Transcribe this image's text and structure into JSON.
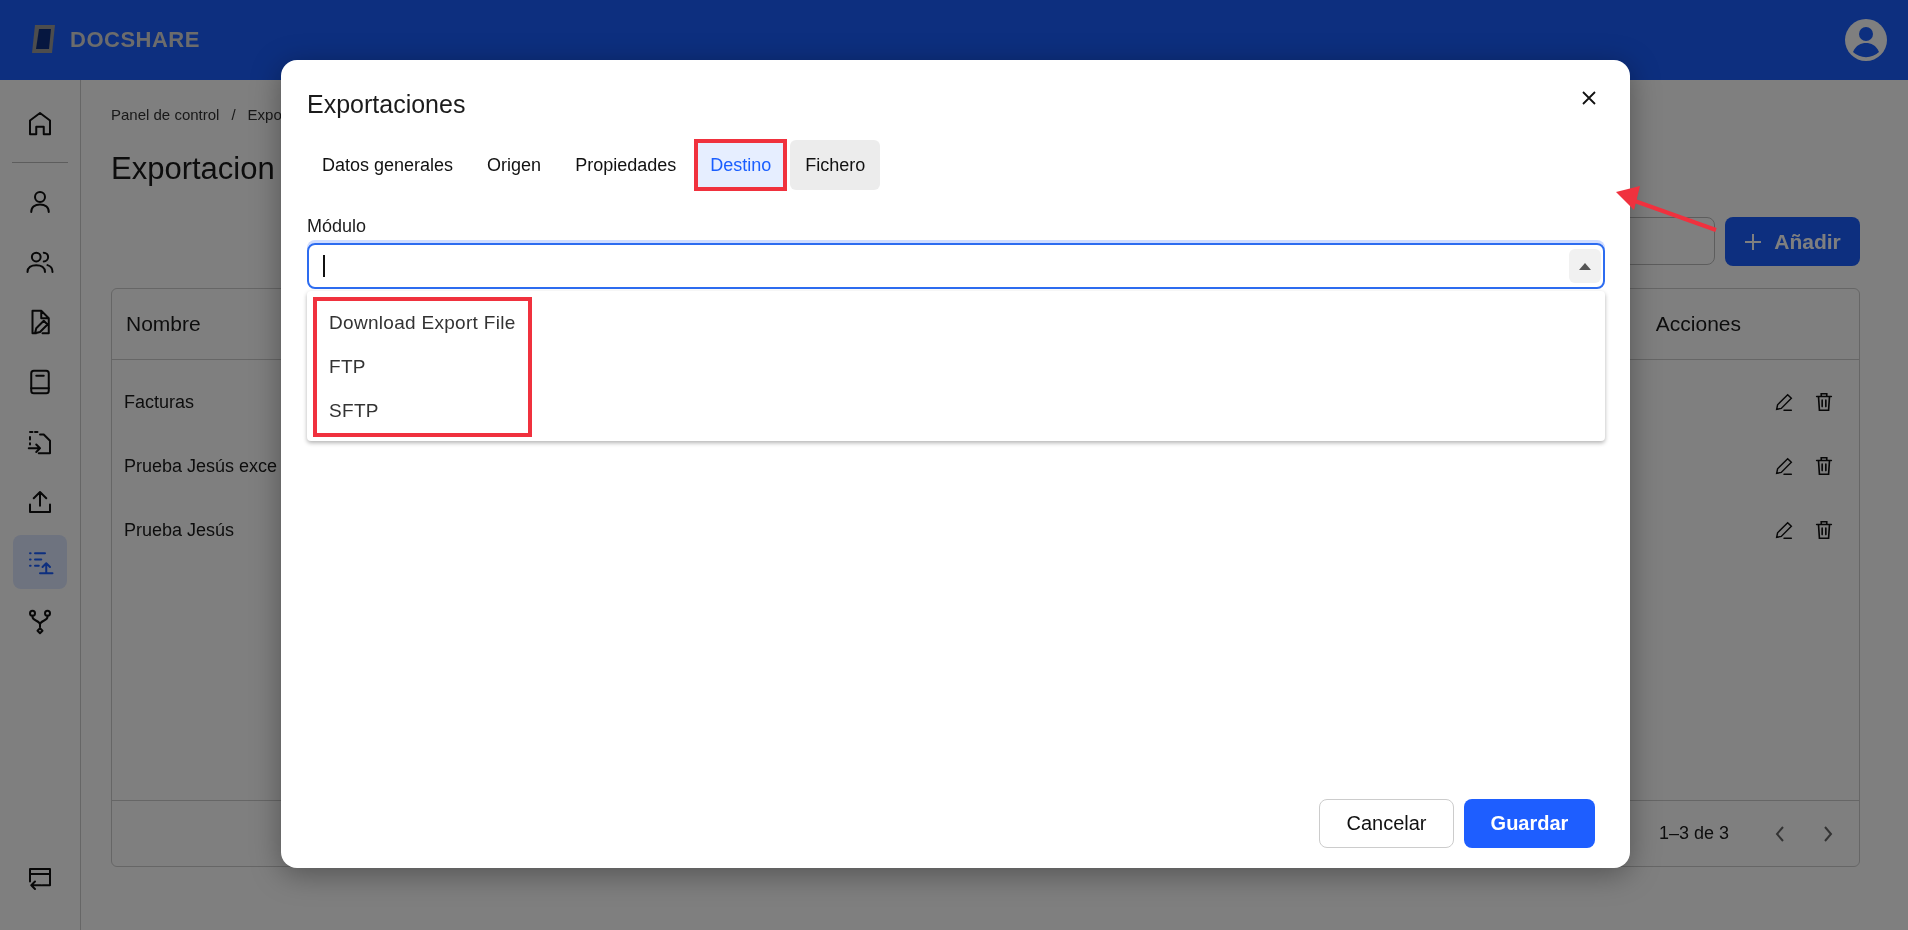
{
  "header": {
    "brand": "DOCSHARE"
  },
  "sidebar": {
    "items": [
      {
        "selected": false
      },
      {
        "selected": false
      },
      {
        "selected": false
      },
      {
        "selected": false
      },
      {
        "selected": false
      },
      {
        "selected": false
      },
      {
        "selected": false
      },
      {
        "selected": true
      },
      {
        "selected": false
      }
    ]
  },
  "breadcrumb": [
    "Panel de control",
    "Expo"
  ],
  "breadcrumb_separator": "/",
  "page_title": "Exportacion",
  "add_button": "Añadir",
  "table": {
    "columns": [
      "Nombre",
      "Acciones"
    ],
    "rows": [
      {
        "name": "Facturas"
      },
      {
        "name": "Prueba Jesús exce"
      },
      {
        "name": "Prueba Jesús"
      }
    ],
    "pagination": "1–3 de 3"
  },
  "modal": {
    "title": "Exportaciones",
    "tabs": [
      {
        "label": "Datos generales",
        "selected": false,
        "hovered": false,
        "highlighted": false
      },
      {
        "label": "Origen",
        "selected": false,
        "hovered": false,
        "highlighted": false
      },
      {
        "label": "Propiedades",
        "selected": false,
        "hovered": false,
        "highlighted": false
      },
      {
        "label": "Destino",
        "selected": true,
        "hovered": false,
        "highlighted": true
      },
      {
        "label": "Fichero",
        "selected": false,
        "hovered": true,
        "highlighted": false
      }
    ],
    "field": {
      "label": "Módulo",
      "open": true
    },
    "options": [
      {
        "label": "Download Export File"
      },
      {
        "label": "FTP"
      },
      {
        "label": "SFTP"
      }
    ],
    "options_highlighted": true,
    "cancel": "Cancelar",
    "save": "Guardar"
  },
  "annotation_arrow": true
}
